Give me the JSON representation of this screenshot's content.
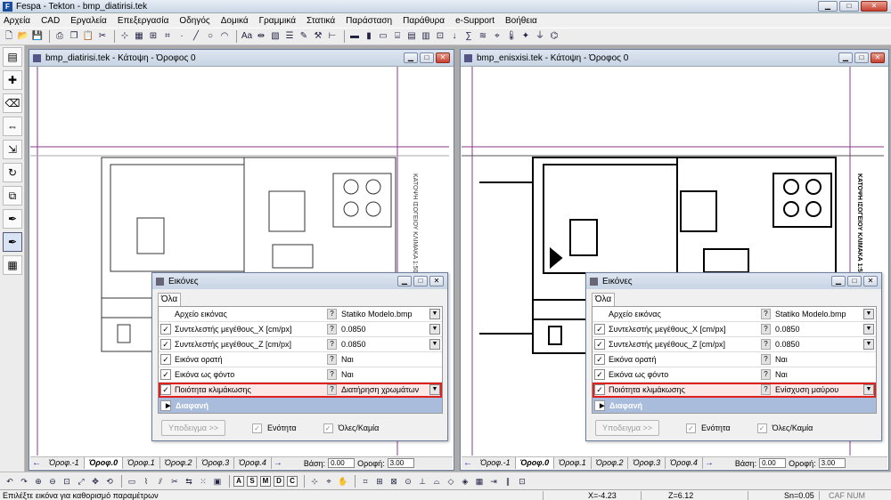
{
  "app": {
    "title": "Fespa - Tekton - bmp_diatirisi.tek"
  },
  "window_controls": {
    "min": "▁",
    "max": "□",
    "close": "✕"
  },
  "menu": [
    "Αρχεία",
    "CAD",
    "Εργαλεία",
    "Επεξεργασία",
    "Οδηγός",
    "Δομικά",
    "Γραμμικά",
    "Στατικά",
    "Παράσταση",
    "Παράθυρα",
    "e-Support",
    "Βοήθεια"
  ],
  "left_window": {
    "title": "bmp_diatirisi.tek - Κάτοψη - Όροφος 0",
    "floor_tabs": [
      "Όροφ.-1",
      "Όροφ.0",
      "Όροφ.1",
      "Όροφ.2",
      "Όροφ.3",
      "Όροφ.4"
    ],
    "active_tab": "Όροφ.0",
    "base_label": "Βάση:",
    "base_value": "0.00",
    "roof_label": "Οροφή:",
    "roof_value": "3.00"
  },
  "right_window": {
    "title": "bmp_enisxisi.tek - Κάτοψη - Όροφος 0",
    "floor_tabs": [
      "Όροφ.-1",
      "Όροφ.0",
      "Όροφ.1",
      "Όροφ.2",
      "Όροφ.3",
      "Όροφ.4"
    ],
    "active_tab": "Όροφ.0",
    "base_label": "Βάση:",
    "base_value": "0.00",
    "roof_label": "Οροφή:",
    "roof_value": "3.00"
  },
  "left_dialog": {
    "title": "Εικόνες",
    "tab": "Όλα",
    "rows": [
      {
        "name": "Αρχείο εικόνας",
        "value": "Statiko Modelo.bmp",
        "checked": false
      },
      {
        "name": "Συντελεστής μεγέθους_X [cm/px]",
        "value": "0.0850",
        "checked": true
      },
      {
        "name": "Συντελεστής μεγέθους_Z [cm/px]",
        "value": "0.0850",
        "checked": true
      },
      {
        "name": "Εικόνα ορατή",
        "value": "Ναι",
        "checked": true
      },
      {
        "name": "Εικόνα ως φόντο",
        "value": "Ναι",
        "checked": true
      },
      {
        "name": "Ποιότητα κλιμάκωσης",
        "value": "Διατήρηση χρωμάτων",
        "checked": true
      }
    ],
    "section": "Διαφανή",
    "sample_btn": "Υποδειγμα >>",
    "unity_label": "Ενότητα",
    "all_none_label": "Όλες/Καμία"
  },
  "right_dialog": {
    "title": "Εικόνες",
    "tab": "Όλα",
    "rows": [
      {
        "name": "Αρχείο εικόνας",
        "value": "Statiko Modelo.bmp",
        "checked": false
      },
      {
        "name": "Συντελεστής μεγέθους_X [cm/px]",
        "value": "0.0850",
        "checked": true
      },
      {
        "name": "Συντελεστής μεγέθους_Z [cm/px]",
        "value": "0.0850",
        "checked": true
      },
      {
        "name": "Εικόνα ορατή",
        "value": "Ναι",
        "checked": true
      },
      {
        "name": "Εικόνα ως φόντο",
        "value": "Ναι",
        "checked": true
      },
      {
        "name": "Ποιότητα κλιμάκωσης",
        "value": "Ενίσχυση μαύρου",
        "checked": true
      }
    ],
    "section": "Διαφανή",
    "sample_btn": "Υποδειγμα >>",
    "unity_label": "Ενότητα",
    "all_none_label": "Όλες/Καμία"
  },
  "drawing_text": {
    "vertical_caption": "ΚΑΤΟΨΗ ΙΣΟΓΕΙΟΥ ΚΛΙΜΑΚΑ 1:50"
  },
  "status": {
    "hint": "Επιλέξτε εικόνα για καθορισμό παραμέτρων",
    "x": "X=-4.23",
    "z": "Z=6.12",
    "sn": "Sn=0.05",
    "flags": "CAF  NUM"
  },
  "bottom_letters": [
    "A",
    "S",
    "M",
    "D",
    "C"
  ],
  "highlight_color": "#e0201c"
}
